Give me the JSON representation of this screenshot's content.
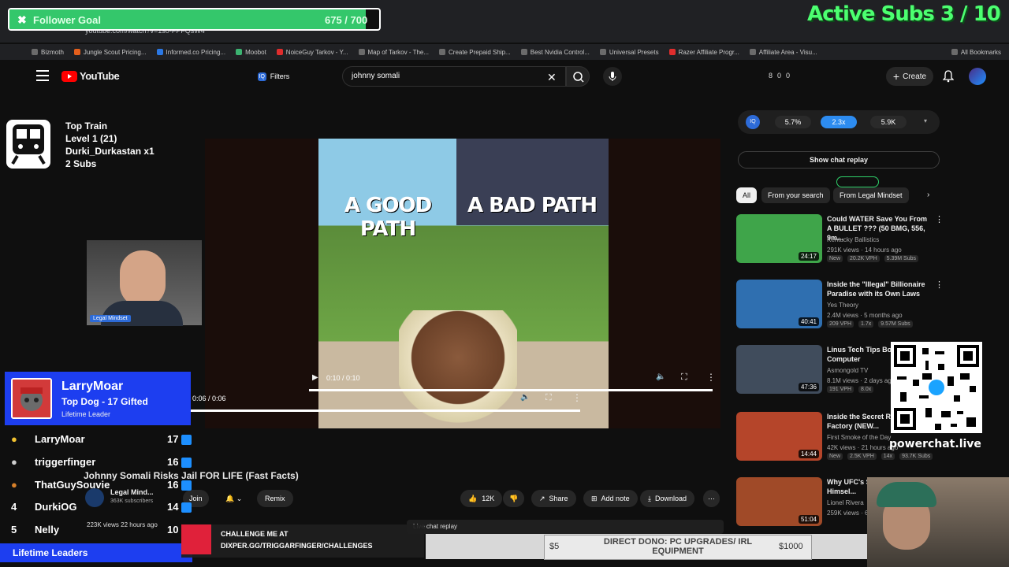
{
  "browser": {
    "address": "youtube.com/watch?v=1s0-FPFQsW4",
    "bookmarks": [
      "Bizmoth",
      "Jungle Scout Pricing...",
      "Informed.co Pricing...",
      "Moobot",
      "NoiceGuy Tarkov - Y...",
      "Map of Tarkov - The...",
      "Create Prepaid Ship...",
      "Best Nvidia Control...",
      "Universal Presets",
      "Razer Affiliate Progr...",
      "Affiliate Area - Visu..."
    ],
    "all_bookmarks": "All Bookmarks"
  },
  "youtube": {
    "logo": "YouTube",
    "filters": "Filters",
    "search_value": "johnny somali",
    "stats": [
      "8",
      "0",
      "0"
    ],
    "create": "Create"
  },
  "player": {
    "thumb_left_text": "A GOOD PATH",
    "thumb_right_text": "A BAD PATH",
    "time_inner": "0:10 / 0:10",
    "time_outer": "0:06 / 0:06"
  },
  "side": {
    "pcts": [
      "5.7%",
      "2.3x",
      "5.9K"
    ],
    "iq": "IQ",
    "show_chat_replay": "Show chat replay",
    "tabs": [
      "All",
      "From your search",
      "From Legal Mindset"
    ],
    "recs": [
      {
        "title": "Could WATER Save You From A BULLET ??? (50 BMG, 556, 9m...",
        "channel": "Kentucky Ballistics",
        "meta": "291K views · 14 hours ago",
        "badges": [
          "New",
          "20.2K VPH",
          "5.39M Subs"
        ],
        "dur": "24:17",
        "thumb": "#3fa54a"
      },
      {
        "title": "Inside the \"Illegal\" Billionaire Paradise with its Own Laws",
        "channel": "Yes Theory",
        "meta": "2.4M views · 5 months ago",
        "badges": [
          "209 VPH",
          "1.7x",
          "9.57M Subs"
        ],
        "dur": "40:41",
        "thumb": "#2f6fb0"
      },
      {
        "title": "Linus Tech Tips Bou... Computer",
        "channel": "Asmongold TV",
        "meta": "8.1M views · 2 days ago",
        "badges": [
          "191 VPH",
          "8.0x"
        ],
        "dur": "47:36",
        "thumb": "#404c5c"
      },
      {
        "title": "Inside the Secret RA... Paper Factory (NEW...",
        "channel": "First Smoke of the Day",
        "meta": "42K views · 21 hours ago",
        "badges": [
          "New",
          "2.5K VPH",
          "14x",
          "93.7K Subs"
        ],
        "dur": "14:44",
        "thumb": "#b5452a"
      },
      {
        "title": "Why UFC's Sn... Broke Himsel...",
        "channel": "Lionel Rivera",
        "meta": "259K views · 6 days ago",
        "badges": [],
        "dur": "51:04",
        "thumb": "#a04a28"
      }
    ]
  },
  "video": {
    "title": "Johnny Somali Risks Jail FOR LIFE (Fast Facts)",
    "channel": "Legal Mind...",
    "subs": "363K subscribers",
    "join": "Join",
    "remix": "Remix",
    "likes": "12K",
    "share": "Share",
    "add_note": "Add note",
    "download": "Download",
    "views": "223K views 22 hours ago",
    "live_chat": "Live chat replay"
  },
  "overlay": {
    "goal_label": "Follower Goal",
    "goal_count": "675 / 700",
    "goal_progress": 0.964,
    "active_subs": "Active Subs  3 / 10",
    "train": [
      "Top Train",
      "Level 1  (21)",
      "Durki_Durkastan x1",
      "2 Subs"
    ],
    "cam_label": "Legal Mindset",
    "leader": {
      "name": "LarryMoar",
      "sub": "Top Dog - 17 Gifted",
      "tag": "Lifetime Leader"
    },
    "leaderboard": [
      {
        "rank": "",
        "name": "LarryMoar",
        "count": "17"
      },
      {
        "rank": "",
        "name": "triggerfinger",
        "count": "16"
      },
      {
        "rank": "",
        "name": "ThatGuySouvie",
        "count": "16"
      },
      {
        "rank": "4",
        "name": "DurkiOG",
        "count": "14"
      },
      {
        "rank": "5",
        "name": "Nelly",
        "count": "10"
      }
    ],
    "leaders_footer": "Lifetime Leaders",
    "challenge_1": "CHALLENGE ME AT",
    "challenge_2": "DIXPER.GG/TRIGGARFINGER/CHALLENGES",
    "dono_low": "$5",
    "dono_high": "$1000",
    "dono_text": "DIRECT DONO: PC UPGRADES/ IRL EQUIPMENT",
    "powerchat": "powerchat.live"
  }
}
